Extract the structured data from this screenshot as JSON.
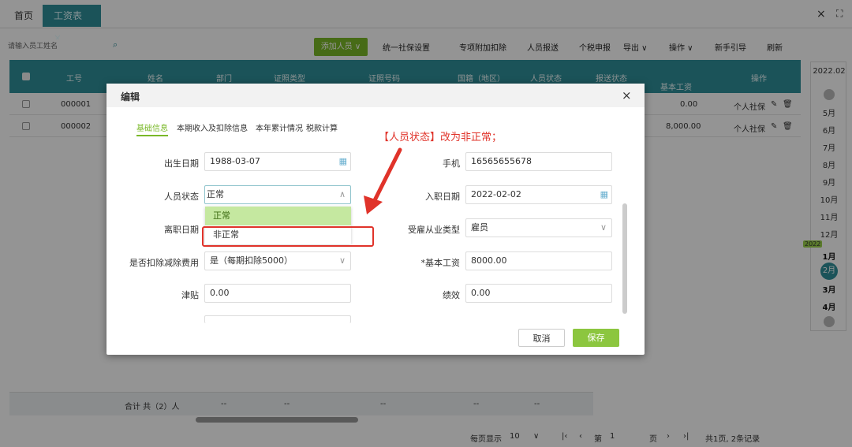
{
  "tabs": [
    {
      "label": "首页"
    },
    {
      "label": "工资表 ×"
    }
  ],
  "window": {
    "close": "×",
    "fullscreen": "⛶"
  },
  "search": {
    "placeholder": "请输入员工姓名"
  },
  "toolbar": {
    "add": "添加人员 ∨",
    "items": [
      "统一社保设置",
      "专项附加扣除",
      "人员报送",
      "个税申报",
      "导出 ∨",
      "操作 ∨",
      "新手引导",
      "刷新"
    ]
  },
  "table": {
    "headers": [
      "工号",
      "姓名",
      "部门",
      "证照类型",
      "证照号码",
      "国籍（地区）",
      "人员状态",
      "报送状态",
      "基本工资",
      "操作"
    ],
    "rows": [
      {
        "id": "000001",
        "salary": "0.00",
        "action": "个人社保"
      },
      {
        "id": "000002",
        "salary": "8,000.00",
        "action": "个人社保"
      }
    ],
    "total": "合计 共（2）人",
    "dash": "--"
  },
  "pagination": {
    "per_page_label": "每页显示",
    "per_page": "10",
    "page_prefix": "第",
    "page": "1",
    "page_suffix": "页",
    "summary": "共1页, 2条记录"
  },
  "datepicker": {
    "current": "2022.02",
    "year_badge": "2022",
    "months": [
      "5月",
      "6月",
      "7月",
      "8月",
      "9月",
      "10月",
      "11月",
      "12月",
      "1月",
      "2月",
      "3月",
      "4月"
    ],
    "selected": "2月"
  },
  "modal": {
    "title": "编辑",
    "close": "×",
    "tabs": [
      "基础信息",
      "本期收入及扣除信息",
      "本年累计情况",
      "税款计算"
    ],
    "annotation": "【人员状态】改为非正常；",
    "left": [
      {
        "label": "出生日期",
        "value": "1988-03-07"
      },
      {
        "label": "人员状态",
        "value": "正常"
      },
      {
        "label": "离职日期",
        "value": ""
      },
      {
        "label": "是否扣除减除费用",
        "value": "是（每期扣除5000）"
      },
      {
        "label": "津贴",
        "value": "0.00"
      }
    ],
    "right": [
      {
        "label": "手机",
        "value": "16565655678"
      },
      {
        "label": "入职日期",
        "value": "2022-02-02"
      },
      {
        "label": "受雇从业类型",
        "value": "雇员"
      },
      {
        "label": "*基本工资",
        "value": "8000.00"
      },
      {
        "label": "绩效",
        "value": "0.00"
      }
    ],
    "dropdown": [
      "正常",
      "非正常"
    ],
    "cancel": "取消",
    "save": "保存"
  },
  "colors": {
    "accent": "#2f8f9a",
    "green": "#7ab828",
    "annotation": "#e0332a"
  }
}
